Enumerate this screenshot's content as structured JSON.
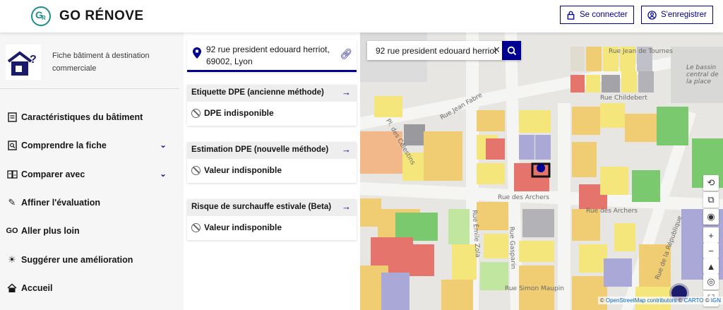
{
  "header": {
    "brand": "GO RÉNOVE",
    "logo_text_g": "G",
    "logo_text_r": "R",
    "login_label": "Se connecter",
    "register_label": "S'enregistrer"
  },
  "sidebar": {
    "building_title": "Fiche bâtiment à destination commerciale",
    "items": [
      {
        "label": "Caractéristiques du bâtiment",
        "icon": "document-icon"
      },
      {
        "label": "Comprendre la fiche",
        "icon": "search-document-icon",
        "expandable": true
      },
      {
        "label": "Comparer avec",
        "icon": "compare-icon",
        "expandable": true
      },
      {
        "label": "Affiner l'évaluation",
        "icon": "pencil-icon"
      },
      {
        "label": "Aller plus loin",
        "icon": "link-icon"
      },
      {
        "label": "Suggérer une amélioration",
        "icon": "lightbulb-icon"
      },
      {
        "label": "Accueil",
        "icon": "home-icon"
      }
    ]
  },
  "panel": {
    "address": "92 rue president edouard herriot, 69002, Lyon",
    "cards": [
      {
        "title": "Etiquette DPE (ancienne méthode)",
        "value": "DPE indisponible"
      },
      {
        "title": "Estimation DPE (nouvelle méthode)",
        "value": "Valeur indisponible"
      },
      {
        "title": "Risque de surchauffe estivale (Beta)",
        "value": "Valeur indisponible"
      }
    ]
  },
  "map": {
    "search_value": "92 rue president edouard herriot",
    "attribution_prefix": "©",
    "attribution_osm": "OpenStreetMap contributors",
    "attribution_carto": "CARTO",
    "attribution_ign": "IGN",
    "streets": {
      "jean_de_tournes": "Rue Jean de Tournes",
      "childebert": "Rue Childebert",
      "jean_fabre": "Rue Jean Fabre",
      "archers_1": "Rue des Archers",
      "archers_2": "Rue des Archers",
      "celestins": "Pl. des Célestins",
      "emile_zola": "Rue Émile Zola",
      "gasparin": "Rue Gasparin",
      "simon_maupin": "Rue Simon Maupin",
      "republique": "Rue de la République",
      "place_basin": "Le bassin central de la place"
    }
  }
}
